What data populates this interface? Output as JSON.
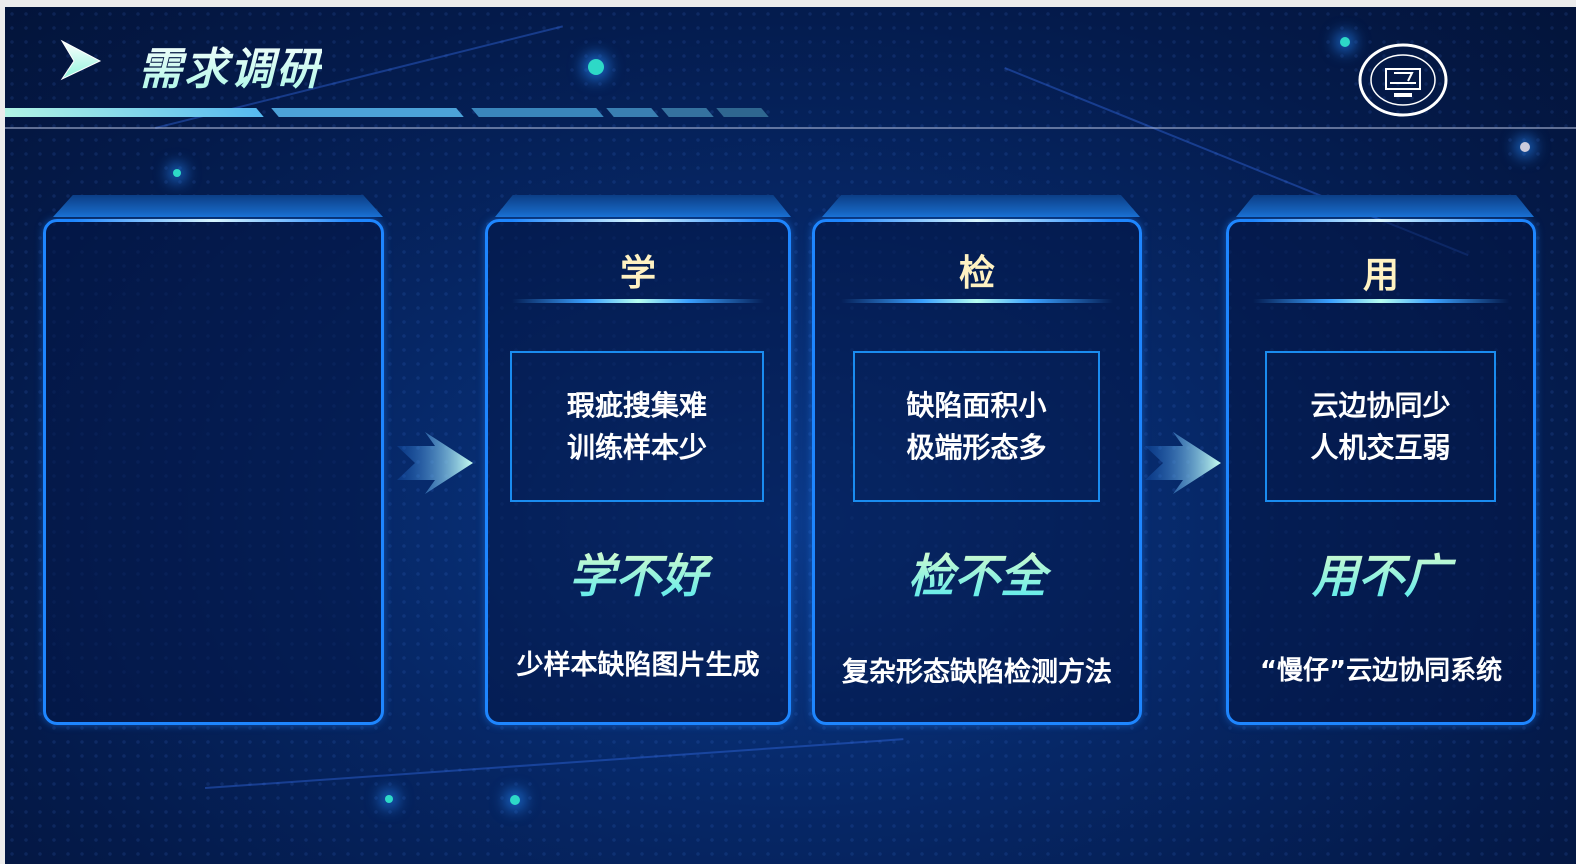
{
  "slide": {
    "title": "需求调研",
    "logo": "university-seal",
    "accent": "#1e86ff"
  },
  "cards": [
    {},
    {
      "head": "学",
      "lines": [
        "瑕疵搜集难",
        "训练样本少"
      ],
      "slogan": "学不好",
      "desc": "少样本缺陷图片生成"
    },
    {
      "head": "检",
      "lines": [
        "缺陷面积小",
        "极端形态多"
      ],
      "slogan": "检不全",
      "desc": "复杂形态缺陷检测方法"
    },
    {
      "head": "用",
      "lines": [
        "云边协同少",
        "人机交互弱"
      ],
      "slogan": "用不广",
      "desc": "“慢仔”云边协同系统"
    }
  ]
}
